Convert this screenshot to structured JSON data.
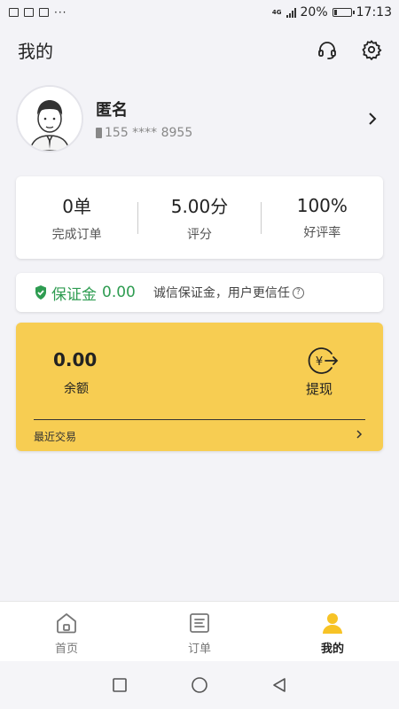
{
  "status_bar": {
    "network": "4G",
    "battery": "20%",
    "time": "17:13",
    "more": "···"
  },
  "header": {
    "title": "我的",
    "icons": [
      "headset-icon",
      "gear-icon"
    ]
  },
  "profile": {
    "name": "匿名",
    "phone": "155 **** 8955"
  },
  "stats": [
    {
      "value": "0单",
      "label": "完成订单"
    },
    {
      "value": "5.00分",
      "label": "评分"
    },
    {
      "value": "100%",
      "label": "好评率"
    }
  ],
  "deposit": {
    "label": "保证金",
    "amount": "0.00",
    "description": "诚信保证金，用户更信任",
    "help": "?"
  },
  "balance": {
    "amount": "0.00",
    "label": "余额",
    "withdraw": "提现",
    "withdraw_symbol": "¥",
    "recent": "最近交易"
  },
  "nav": [
    {
      "label": "首页",
      "icon": "home-icon"
    },
    {
      "label": "订单",
      "icon": "orders-icon"
    },
    {
      "label": "我的",
      "icon": "profile-icon",
      "active": true
    }
  ],
  "colors": {
    "accent": "#f7cd52",
    "deposit_green": "#2e9c51",
    "background": "#f3f3f7"
  }
}
